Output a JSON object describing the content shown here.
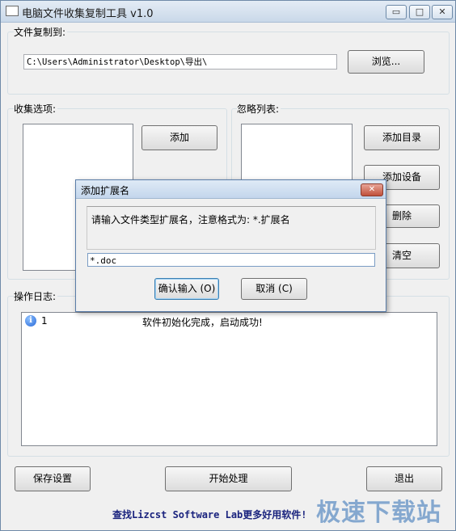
{
  "window": {
    "title": "电脑文件收集复制工具 v1.0",
    "minimize_glyph": "▭",
    "maximize_glyph": "□",
    "close_glyph": "✕"
  },
  "copy_to": {
    "label": "文件复制到:",
    "path": "C:\\Users\\Administrator\\Desktop\\导出\\",
    "browse_label": "浏览..."
  },
  "collect": {
    "label": "收集选项:",
    "add_label": "添加"
  },
  "ignore": {
    "label": "忽略列表:",
    "add_dir_label": "添加目录",
    "add_device_label": "添加设备",
    "delete_label": "删除",
    "clear_label": "清空"
  },
  "log": {
    "label": "操作日志:",
    "entries": [
      {
        "icon": "info-icon",
        "index": "1",
        "message": "软件初始化完成，启动成功!"
      }
    ]
  },
  "footer": {
    "save_label": "保存设置",
    "start_label": "开始处理",
    "exit_label": "退出",
    "link_text": "查找Lizcst Software Lab更多好用软件!"
  },
  "dialog": {
    "title": "添加扩展名",
    "close_glyph": "✕",
    "message": "请输入文件类型扩展名，注意格式为: *.扩展名",
    "input_value": "*.doc",
    "confirm_label": "确认输入 (O)",
    "cancel_label": "取消 (C)"
  },
  "watermark": "极速下载站",
  "colors": {
    "link": "#1a237e",
    "watermark": "#2f6fb5",
    "dialog_border": "#5a7da8"
  }
}
